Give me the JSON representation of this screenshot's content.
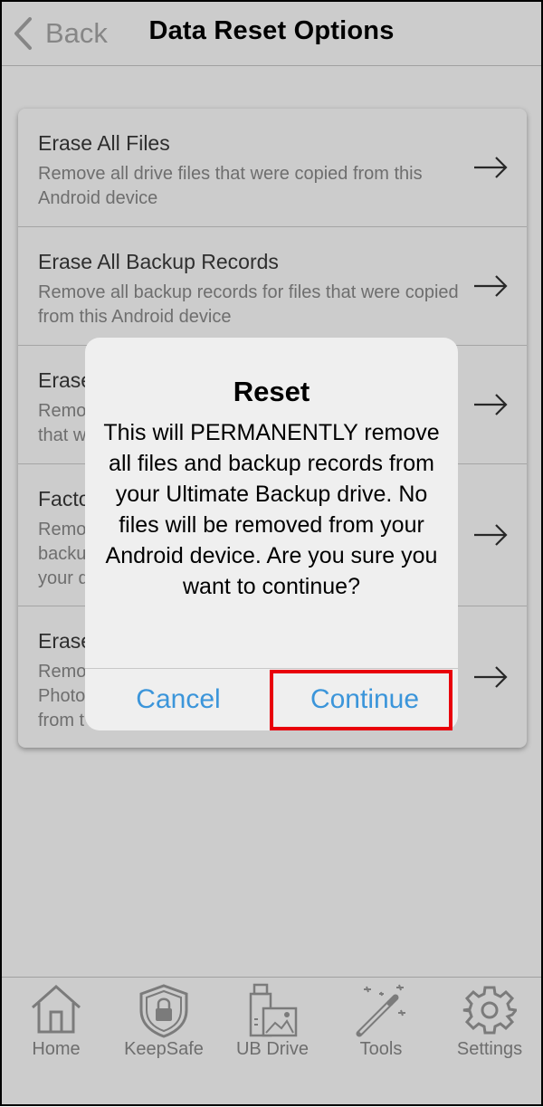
{
  "header": {
    "back_label": "Back",
    "title": "Data Reset Options"
  },
  "list": {
    "items": [
      {
        "title": "Erase All Files",
        "description": "Remove all drive files that were copied from this Android device",
        "icon": "arrow-right-icon"
      },
      {
        "title": "Erase All Backup Records",
        "description": "Remove all backup records for files that were copied from this Android device",
        "icon": "arrow-right-icon"
      },
      {
        "title": "Erase",
        "description": "Remo that w",
        "icon": "arrow-right-icon"
      },
      {
        "title": "Facto",
        "description": "Remo backu your d",
        "icon": "arrow-right-icon"
      },
      {
        "title": "Erase",
        "description": "Remo Photo from t",
        "icon": "arrow-right-icon"
      }
    ]
  },
  "dialog": {
    "title": "Reset",
    "message": "This will PERMANENTLY remove all files and backup records from your Ultimate Backup drive. No files will be removed from your Android device. Are you sure you want to continue?",
    "cancel_label": "Cancel",
    "continue_label": "Continue"
  },
  "tabbar": {
    "tabs": [
      {
        "label": "Home",
        "icon": "home-icon"
      },
      {
        "label": "KeepSafe",
        "icon": "shield-lock-icon"
      },
      {
        "label": "UB Drive",
        "icon": "drive-photo-icon"
      },
      {
        "label": "Tools",
        "icon": "magic-wand-icon"
      },
      {
        "label": "Settings",
        "icon": "gear-icon"
      }
    ]
  },
  "colors": {
    "accent": "#3b95da",
    "highlight": "#e8000b",
    "muted": "#8a8a8a"
  }
}
